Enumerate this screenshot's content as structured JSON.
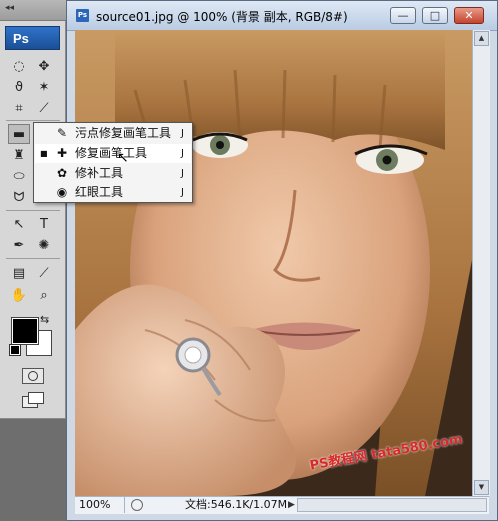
{
  "document": {
    "title": "source01.jpg @ 100% (背景 副本, RGB/8#)",
    "icon_text": "Ps",
    "minimize_symbol": "—",
    "maximize_symbol": "□",
    "close_symbol": "✕"
  },
  "toolbox": {
    "collapse_symbol": "◂◂",
    "logo": "Ps",
    "foreground_color": "#000000",
    "background_color": "#ffffff"
  },
  "flyout": {
    "items": [
      {
        "label": "污点修复画笔工具",
        "key": "J",
        "icon": "spot-healing-brush-icon",
        "selected": false
      },
      {
        "label": "修复画笔工具",
        "key": "J",
        "icon": "healing-brush-icon",
        "selected": true
      },
      {
        "label": "修补工具",
        "key": "J",
        "icon": "patch-icon",
        "selected": false
      },
      {
        "label": "红眼工具",
        "key": "J",
        "icon": "red-eye-icon",
        "selected": false
      }
    ],
    "selected_marker": "■"
  },
  "status": {
    "zoom": "100%",
    "doc_size": "文档:546.1K/1.07M",
    "arrow": "▶"
  },
  "watermark": "PS教程网 tata580.com"
}
